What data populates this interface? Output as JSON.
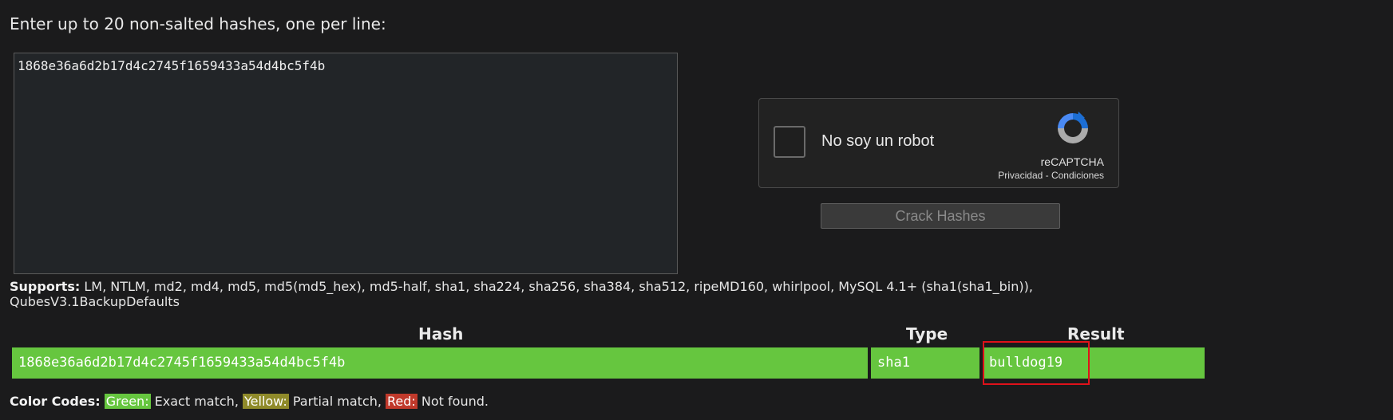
{
  "prompt": "Enter up to 20 non-salted hashes, one per line:",
  "input": {
    "value": "1868e36a6d2b17d4c2745f1659433a54d4bc5f4b"
  },
  "captcha": {
    "label": "No soy un robot",
    "brand": "reCAPTCHA",
    "links": "Privacidad - Condiciones"
  },
  "crack_button": "Crack Hashes",
  "supports": {
    "label": "Supports:",
    "list": "LM, NTLM, md2, md4, md5, md5(md5_hex), md5-half, sha1, sha224, sha256, sha384, sha512, ripeMD160, whirlpool, MySQL 4.1+ (sha1(sha1_bin)), QubesV3.1BackupDefaults"
  },
  "table": {
    "headers": [
      "Hash",
      "Type",
      "Result"
    ],
    "rows": [
      {
        "hash": "1868e36a6d2b17d4c2745f1659433a54d4bc5f4b",
        "type": "sha1",
        "result": "bulldog19"
      }
    ]
  },
  "legend": {
    "label": "Color Codes:",
    "green": "Green:",
    "green_desc": "Exact match,",
    "yellow": "Yellow:",
    "yellow_desc": "Partial match,",
    "red": "Red:",
    "red_desc": "Not found."
  },
  "colors": {
    "match_green": "#66c63f",
    "partial_yellow": "#8f8a2a",
    "notfound_red": "#c0392b",
    "highlight": "#e0111a"
  }
}
